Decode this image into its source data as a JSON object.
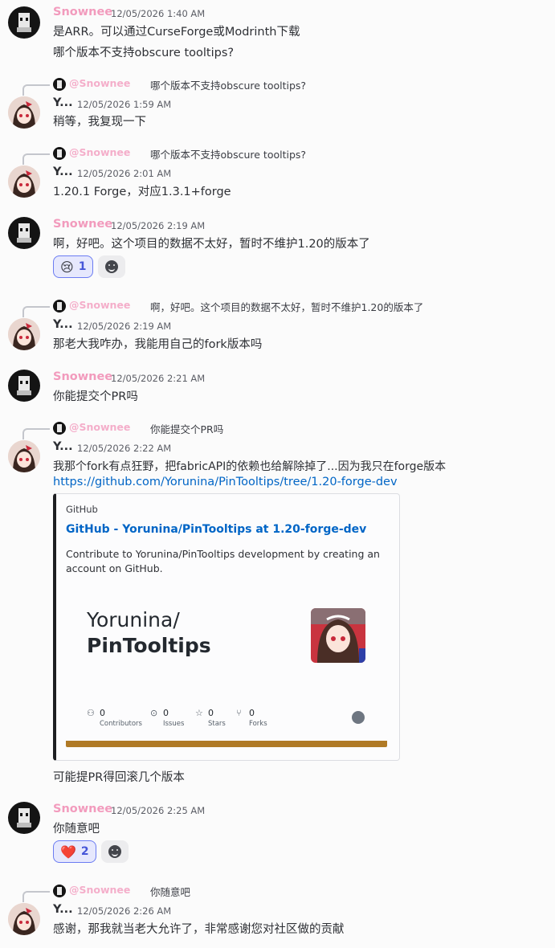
{
  "users": {
    "snownee": "Snownee",
    "yorunina": "Y..."
  },
  "messages": [
    {
      "author": "Snownee",
      "time": "12/05/2026 1:40 AM",
      "lines": [
        "是ARR。可以通过CurseForge或Modrinth下载",
        "哪个版本不支持obscure tooltips?"
      ]
    },
    {
      "reply_name": "@Snownee",
      "reply_text": "哪个版本不支持obscure tooltips?",
      "author": "Y...",
      "time": "12/05/2026 1:59 AM",
      "lines": [
        "稍等，我复现一下"
      ]
    },
    {
      "reply_name": "@Snownee",
      "reply_text": "哪个版本不支持obscure tooltips?",
      "author": "Y...",
      "time": "12/05/2026 2:01 AM",
      "lines": [
        "1.20.1 Forge，对应1.3.1+forge"
      ]
    },
    {
      "author": "Snownee",
      "time": "12/05/2026 2:19 AM",
      "lines": [
        "啊，好吧。这个项目的数据不太好，暂时不维护1.20的版本了"
      ],
      "reaction_emoji": "😢",
      "reaction_count": "1"
    },
    {
      "reply_name": "@Snownee",
      "reply_text": "啊，好吧。这个项目的数据不太好，暂时不维护1.20的版本了",
      "author": "Y...",
      "time": "12/05/2026 2:19 AM",
      "lines": [
        "那老大我咋办，我能用自己的fork版本吗"
      ]
    },
    {
      "author": "Snownee",
      "time": "12/05/2026 2:21 AM",
      "lines": [
        "你能提交个PR吗"
      ]
    },
    {
      "reply_name": "@Snownee",
      "reply_text": "你能提交个PR吗",
      "author": "Y...",
      "time": "12/05/2026 2:22 AM",
      "lines": [
        "我那个fork有点狂野，把fabricAPI的依赖也给解除掉了...因为我只在forge版本",
        "https://github.com/Yorunina/PinTooltips/tree/1.20-forge-dev",
        "可能提PR得回滚几个版本"
      ]
    },
    {
      "author": "Snownee",
      "time": "12/05/2026 2:25 AM",
      "lines": [
        "你随意吧"
      ],
      "reaction_emoji": "❤️",
      "reaction_count": "2"
    },
    {
      "reply_name": "@Snownee",
      "reply_text": "你随意吧",
      "author": "Y...",
      "time": "12/05/2026 2:26 AM",
      "lines": [
        "感谢，那我就当老大允许了，非常感谢您对社区做的贡献"
      ]
    }
  ],
  "embed": {
    "provider": "GitHub",
    "title": "GitHub - Yorunina/PinTooltips at 1.20-forge-dev",
    "description": "Contribute to Yorunina/PinTooltips development by creating an account on GitHub.",
    "card_line1": "Yorunina/",
    "card_line2": "PinTooltips",
    "stats": [
      {
        "value": "0",
        "label": "Contributors",
        "icon": "contributors-icon"
      },
      {
        "value": "0",
        "label": "Issues",
        "icon": "issues-icon"
      },
      {
        "value": "0",
        "label": "Stars",
        "icon": "stars-icon"
      },
      {
        "value": "0",
        "label": "Forks",
        "icon": "forks-icon"
      }
    ],
    "accent_color": "#b07a26"
  },
  "colors": {
    "snownee_name": "#f29bbd",
    "link": "#0065c6",
    "reaction_border": "#6b7cf2"
  }
}
